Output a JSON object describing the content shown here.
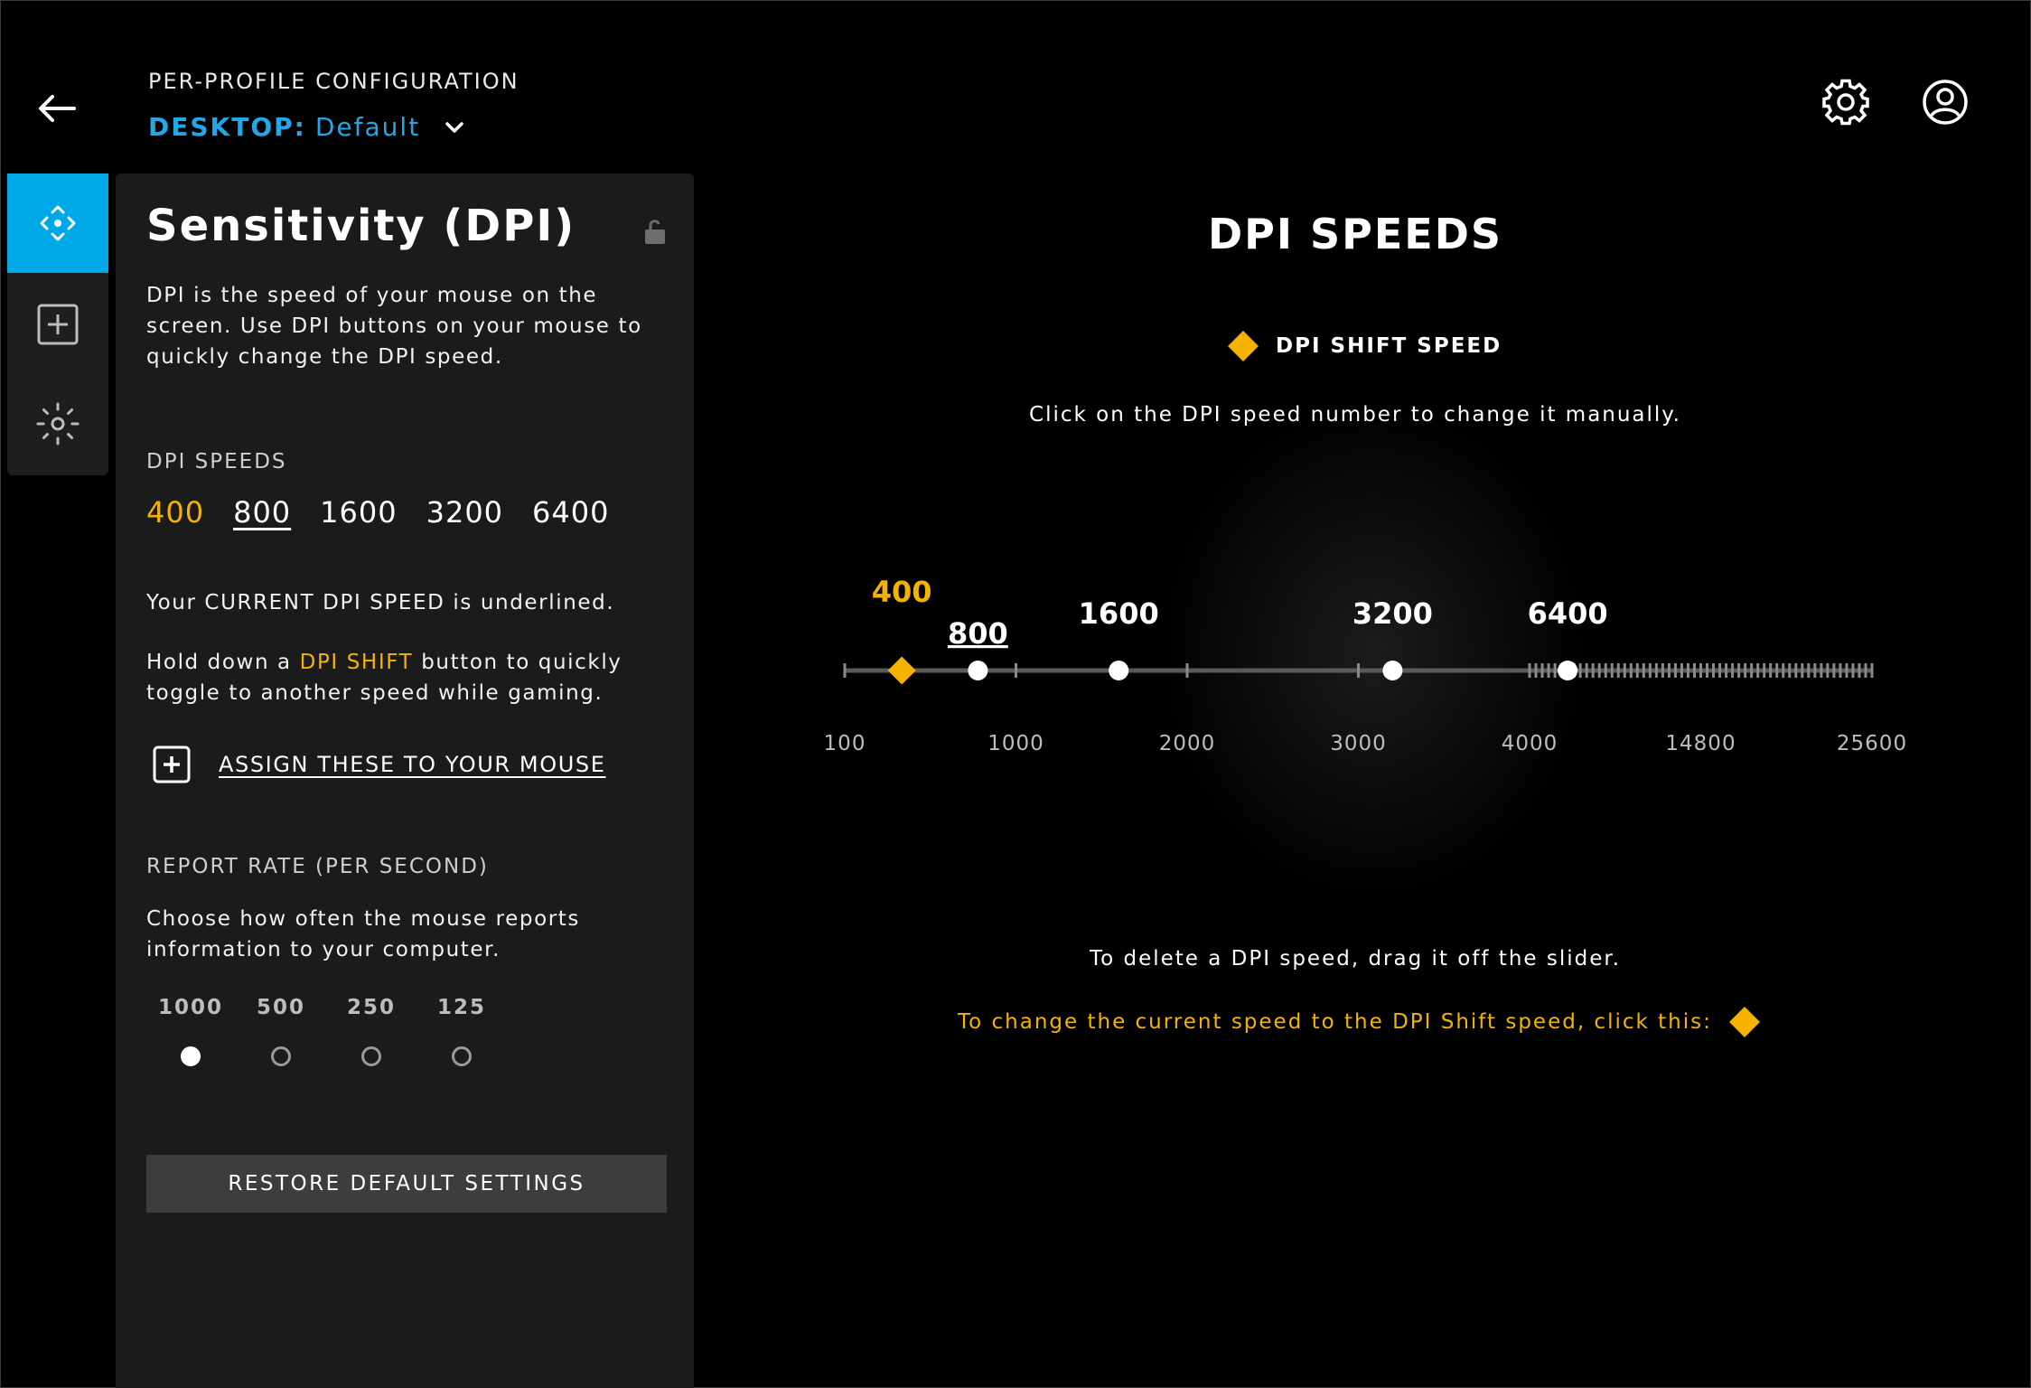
{
  "header": {
    "profile_label": "PER-PROFILE CONFIGURATION",
    "profile_mode": "DESKTOP:",
    "profile_name": "Default",
    "back_icon": "arrow-left-icon",
    "settings_icon": "gear-icon",
    "account_icon": "user-account-icon"
  },
  "rail": {
    "items": [
      {
        "icon": "pointer-move-icon",
        "active": true
      },
      {
        "icon": "assign-plus-icon",
        "active": false
      },
      {
        "icon": "lighting-icon",
        "active": false
      }
    ]
  },
  "panel": {
    "title": "Sensitivity (DPI)",
    "description_lines": [
      "DPI is the speed of your mouse on the",
      "screen. Use DPI buttons on your mouse to",
      "quickly change the DPI speed."
    ],
    "dpi_speeds_label": "DPI SPEEDS",
    "dpi_speeds": [
      "400",
      "800",
      "1600",
      "3200",
      "6400"
    ],
    "shift_speed": "400",
    "current_speed": "800",
    "current_note": "Your CURRENT DPI SPEED is underlined.",
    "shift_line1_pre": "Hold down a ",
    "shift_line1_highlight": "DPI SHIFT",
    "shift_line1_post": " button to quickly",
    "shift_line2": "toggle to another speed while gaming.",
    "assign_label": "ASSIGN THESE TO YOUR MOUSE",
    "report_rate_label": "REPORT RATE (PER SECOND)",
    "report_rate_desc_lines": [
      "Choose how often the mouse reports",
      "information to your computer."
    ],
    "report_rates": [
      "1000",
      "500",
      "250",
      "125"
    ],
    "selected_report_rate": "1000",
    "restore_label": "RESTORE DEFAULT SETTINGS"
  },
  "main": {
    "title": "DPI SPEEDS",
    "legend_label": "DPI SHIFT SPEED",
    "instruction": "Click on the DPI speed number to change it manually.",
    "delete_hint": "To delete a DPI speed, drag it off the slider.",
    "shift_hint": "To change the current speed to the DPI Shift speed, click this:"
  },
  "slider": {
    "scale_labels": [
      "100",
      "1000",
      "2000",
      "3000",
      "4000",
      "14800",
      "25600"
    ],
    "scale_values": [
      100,
      1000,
      2000,
      3000,
      4000,
      14800,
      25600
    ],
    "points": [
      {
        "label": "400",
        "value": 400,
        "kind": "shift"
      },
      {
        "label": "800",
        "value": 800,
        "kind": "current"
      },
      {
        "label": "1600",
        "value": 1600,
        "kind": "normal"
      },
      {
        "label": "3200",
        "value": 3200,
        "kind": "normal"
      },
      {
        "label": "6400",
        "value": 6400,
        "kind": "normal"
      }
    ]
  },
  "colors": {
    "accent": "#00a8e8",
    "profile_blue": "#22a8e8",
    "shift_yellow": "#f5b300",
    "panel_bg": "#1b1b1b",
    "button_bg": "#3d3d3d"
  }
}
